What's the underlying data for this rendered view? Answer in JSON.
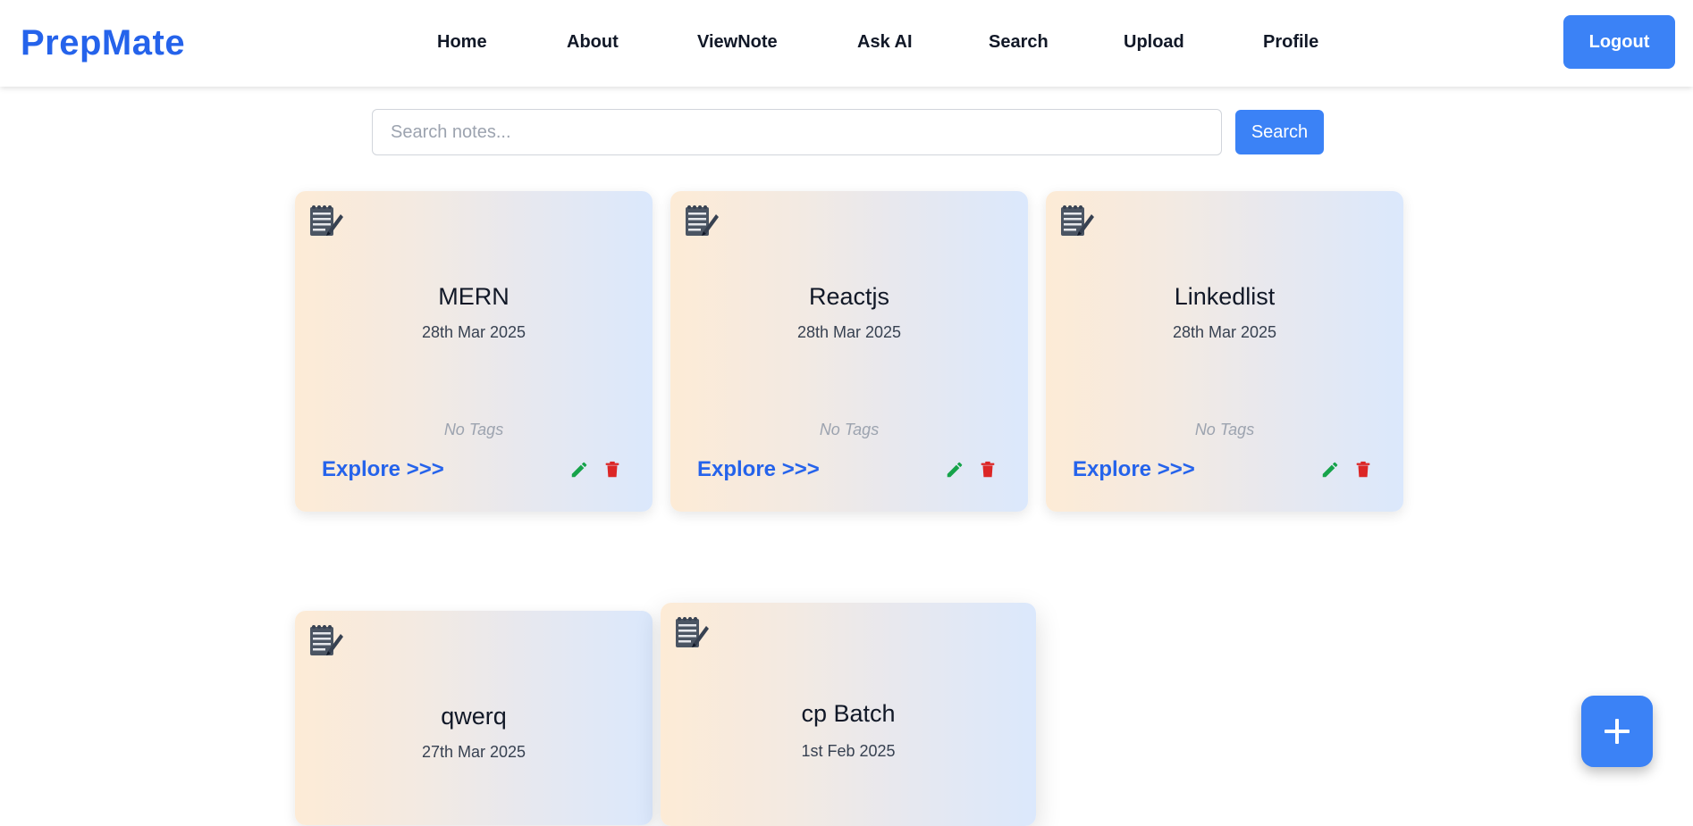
{
  "header": {
    "brand": "PrepMate",
    "nav": [
      {
        "label": "Home"
      },
      {
        "label": "About"
      },
      {
        "label": "ViewNote"
      },
      {
        "label": "Ask AI"
      },
      {
        "label": "Search"
      },
      {
        "label": "Upload"
      },
      {
        "label": "Profile"
      }
    ],
    "logout_label": "Logout"
  },
  "search": {
    "placeholder": "Search notes...",
    "value": "",
    "button_label": "Search"
  },
  "notes": [
    {
      "title": "MERN",
      "date": "28th Mar 2025",
      "tags": "No Tags",
      "explore": "Explore >>>"
    },
    {
      "title": "Reactjs",
      "date": "28th Mar 2025",
      "tags": "No Tags",
      "explore": "Explore >>>"
    },
    {
      "title": "Linkedlist",
      "date": "28th Mar 2025",
      "tags": "No Tags",
      "explore": "Explore >>>"
    },
    {
      "title": "qwerq",
      "date": "27th Mar 2025"
    },
    {
      "title": "cp Batch",
      "date": "1st Feb 2025"
    }
  ],
  "icons": {
    "note": "notepad-icon",
    "edit": "pencil-icon",
    "delete": "trash-icon",
    "add": "plus-icon"
  },
  "colors": {
    "accent": "#3b82f6",
    "brand": "#2563eb",
    "edit": "#16a34a",
    "delete": "#dc2626"
  }
}
